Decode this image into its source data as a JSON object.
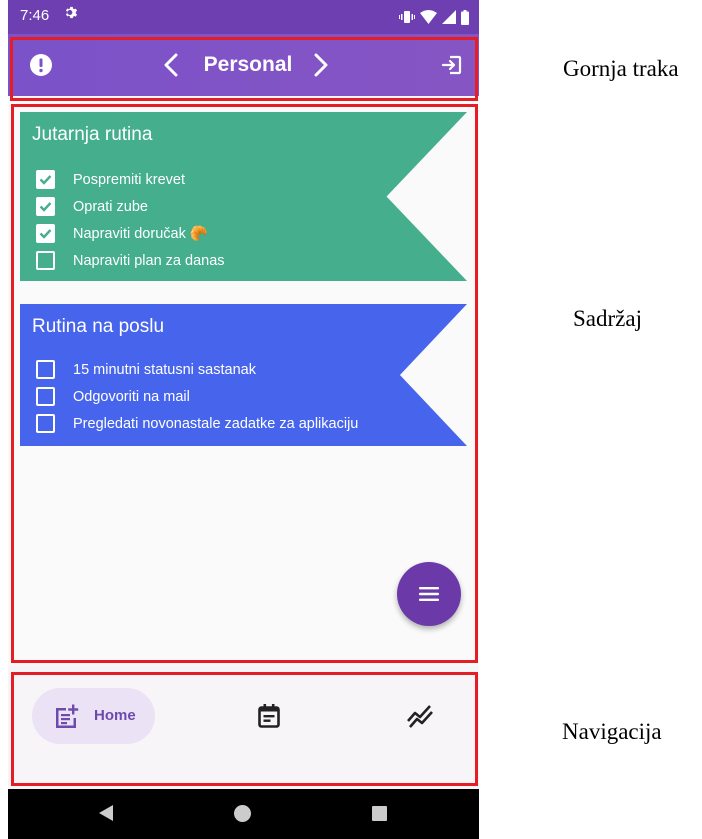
{
  "status_bar": {
    "time": "7:46"
  },
  "app_bar": {
    "title": "Personal"
  },
  "routines": [
    {
      "title": "Jutarnja rutina",
      "color": "#44ae8d",
      "tasks": [
        {
          "label": "Pospremiti krevet",
          "checked": true
        },
        {
          "label": "Oprati zube",
          "checked": true
        },
        {
          "label": "Napraviti doručak 🥐",
          "checked": true
        },
        {
          "label": "Napraviti plan za danas",
          "checked": false
        }
      ]
    },
    {
      "title": "Rutina na poslu",
      "color": "#4765ec",
      "tasks": [
        {
          "label": "15 minutni statusni sastanak",
          "checked": false
        },
        {
          "label": "Odgovoriti na mail",
          "checked": false
        },
        {
          "label": "Pregledati novonastale zadatke za aplikaciju",
          "checked": false
        }
      ]
    }
  ],
  "bottom_nav": {
    "home_label": "Home"
  },
  "annotations": {
    "top_bar": "Gornja traka",
    "content": "Sadržaj",
    "navigation": "Navigacija"
  },
  "colors": {
    "app_bar": "#7b52c9",
    "fab": "#6b3aa8",
    "highlight_outline": "#e51e25",
    "nav_pill": "#ebe3f5"
  }
}
